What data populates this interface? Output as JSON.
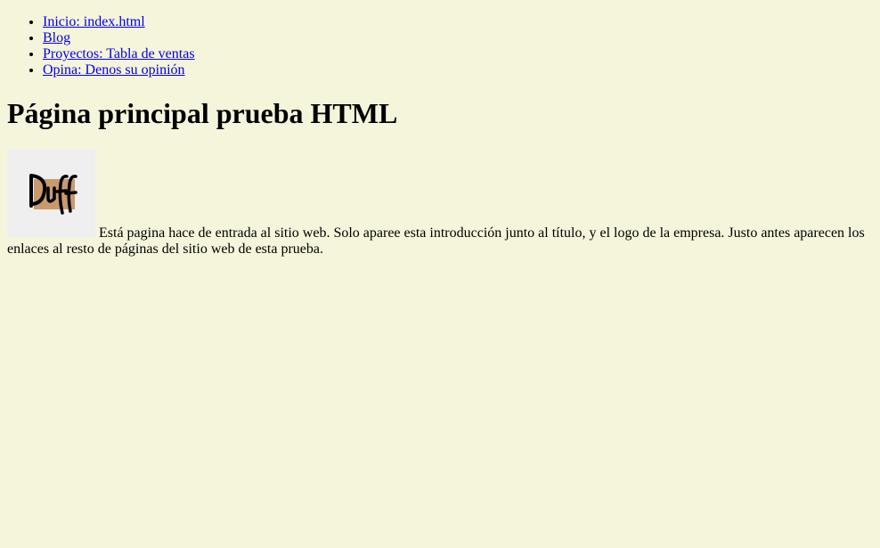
{
  "nav": {
    "items": [
      {
        "label": "Inicio: index.html"
      },
      {
        "label": "Blog"
      },
      {
        "label": "Proyectos: Tabla de ventas"
      },
      {
        "label": "Opina: Denos su opinión"
      }
    ]
  },
  "page_title": "Página principal prueba HTML",
  "logo": {
    "text": "Duff",
    "icon": "duff-logo-icon",
    "bg_color": "#c99a6e"
  },
  "intro_text": "Está pagina hace de entrada al sitio web. Solo aparee esta introducción junto al título, y el logo de la empresa. Justo antes aparecen los enlaces al resto de páginas del sitio web de esta prueba.",
  "colors": {
    "background": "#f5f5dc",
    "link": "#0000ee"
  }
}
